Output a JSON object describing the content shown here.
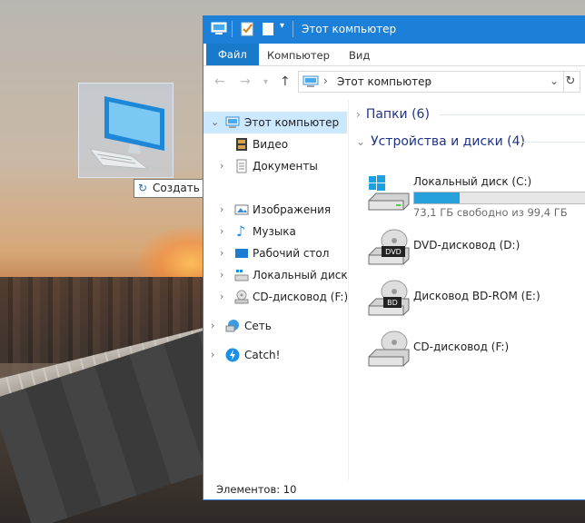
{
  "desktop": {
    "shortcut_tooltip": "Создать ссылку в Рабочий стол"
  },
  "window": {
    "title": "Этот компьютер",
    "ribbon_tabs": [
      "Файл",
      "Компьютер",
      "Вид"
    ],
    "address": {
      "location": "Этот компьютер"
    },
    "nav": {
      "items": [
        {
          "label": "Этот компьютер",
          "icon": "computer-icon"
        },
        {
          "label": "Видео",
          "icon": "video-icon"
        },
        {
          "label": "Документы",
          "icon": "documents-icon"
        },
        {
          "label": "Изображения",
          "icon": "pictures-icon"
        },
        {
          "label": "Музыка",
          "icon": "music-icon"
        },
        {
          "label": "Рабочий стол",
          "icon": "desktop-icon"
        },
        {
          "label": "Локальный диск (C",
          "icon": "local-disk-icon"
        },
        {
          "label": "CD-дисковод (F:)",
          "icon": "cd-drive-icon"
        },
        {
          "label": "Сеть",
          "icon": "network-icon"
        },
        {
          "label": "Catch!",
          "icon": "catch-icon"
        }
      ]
    },
    "groups": {
      "folders": "Папки (6)",
      "devices": "Устройства и диски (4)"
    },
    "drives": [
      {
        "name": "Локальный диск (C:)",
        "free": "73,1 ГБ свободно из 99,4 ГБ",
        "used_fraction": 0.265,
        "icon": "windows-drive-icon"
      },
      {
        "name": "DVD-дисковод (D:)",
        "badge": "DVD",
        "icon": "dvd-drive-icon"
      },
      {
        "name": "Дисковод BD-ROM (E:)",
        "badge": "BD",
        "icon": "bd-drive-icon"
      },
      {
        "name": "CD-дисковод (F:)",
        "icon": "cd-drive-icon"
      }
    ],
    "status": "Элементов: 10"
  },
  "colors": {
    "accent": "#1c7fd8",
    "selection": "#cce8ff",
    "group_title": "#1e3287",
    "progress": "#26a0da"
  }
}
